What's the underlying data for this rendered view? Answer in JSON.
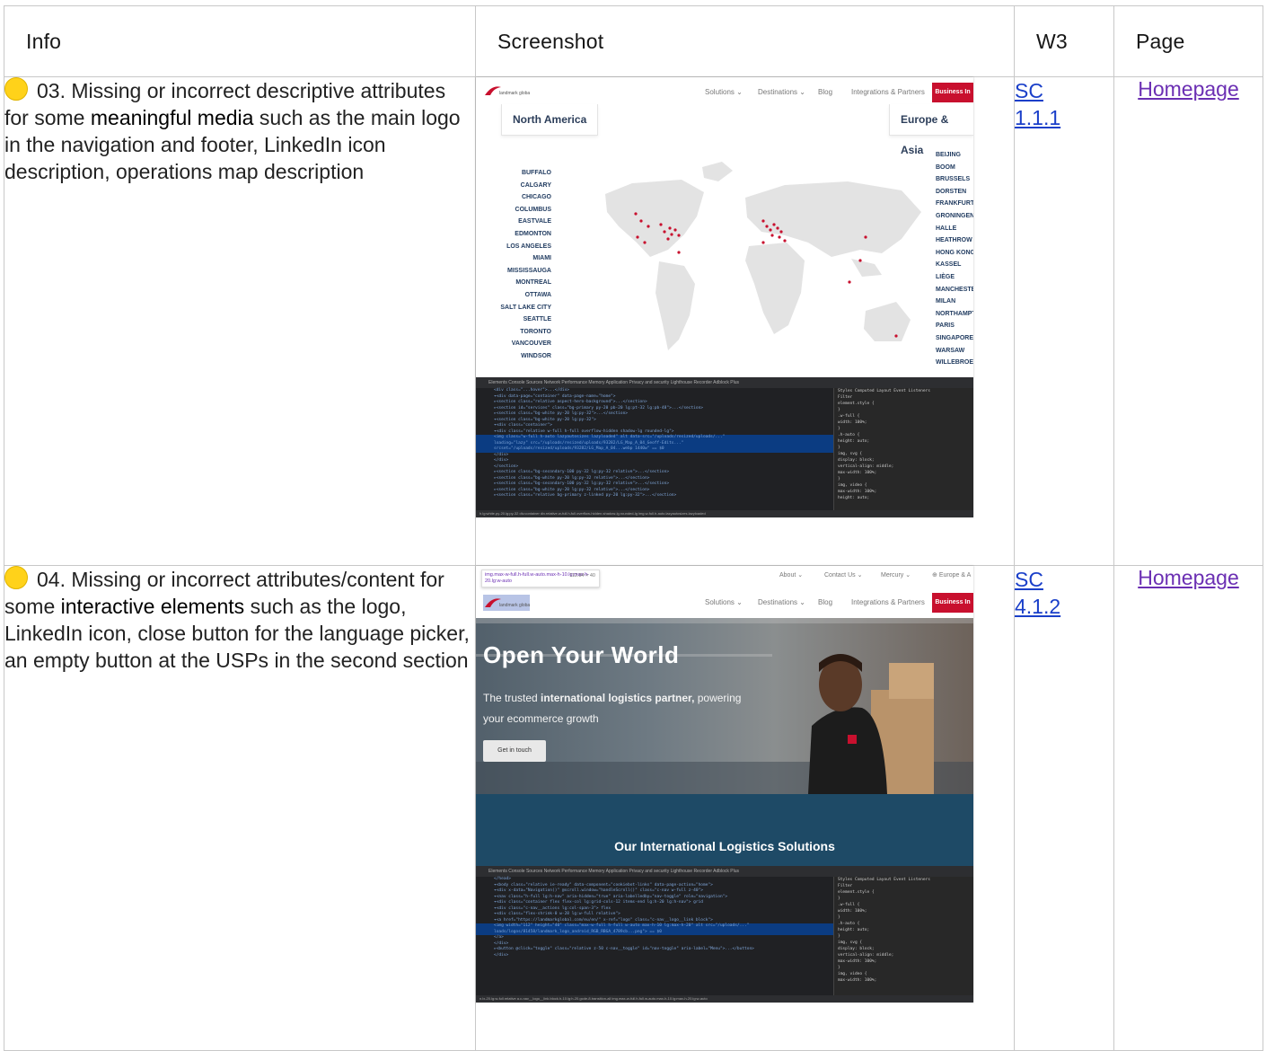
{
  "headers": {
    "info": "Info",
    "screenshot": "Screenshot",
    "w3": "W3",
    "page": "Page"
  },
  "rows": [
    {
      "status_color": "#ffd21a",
      "info_pre": "03. Missing or incorrect descriptive attributes for some ",
      "info_strong": "meaningful media",
      "info_post": " such as the main logo in the navigation and footer, LinkedIn icon description, operations map description",
      "w3_line1": "SC",
      "w3_line2": "1.1.1",
      "page_link": "Homepage",
      "screenshot": {
        "nav_links": [
          "Solutions ⌄",
          "Destinations ⌄",
          "Blog",
          "Integrations & Partners"
        ],
        "business_button": "Business In",
        "region_left": "North America",
        "region_right": "Europe & Asia",
        "cities_left": [
          "BUFFALO",
          "CALGARY",
          "CHICAGO",
          "COLUMBUS",
          "EASTVALE",
          "EDMONTON",
          "LOS ANGELES",
          "MIAMI",
          "MISSISSAUGA",
          "MONTREAL",
          "OTTAWA",
          "SALT LAKE CITY",
          "SEATTLE",
          "TORONTO",
          "VANCOUVER",
          "WINDSOR"
        ],
        "cities_right": [
          "BEIJING",
          "BOOM",
          "BRUSSELS",
          "DORSTEN",
          "FRANKFURT",
          "GRONINGEN",
          "HALLE",
          "HEATHROW",
          "HONG KONG",
          "KASSEL",
          "LIÈGE",
          "MANCHESTER",
          "MILAN",
          "NORTHAMPTON",
          "PARIS",
          "SINGAPORE",
          "WARSAW",
          "WILLEBROEK"
        ],
        "devtools_tabs": "Elements   Console   Sources   Network   Performance   Memory   Application   Privacy and security   Lighthouse   Recorder   Adblock Plus",
        "devtools_styles": [
          "Styles   Computed   Layout   Event Listeners",
          "Filter",
          "element.style {",
          "}",
          ".w-full {",
          "  width: 100%;",
          "}",
          ".h-auto {",
          "  height: auto;",
          "}",
          "img, svg {",
          "  display: block;",
          "  vertical-align: middle;",
          "  max-width: 100%;",
          "}",
          "img, video {",
          "  max-width: 100%;",
          "  height: auto;"
        ],
        "devtools_footer": "h.lg:white.py-20.lg:py-32   div.container   div.relative.w-full.h-full.overflow-hidden.shadow-lg.rounded-lg   img.w-full.h-auto.lazyautosizes.lazyloaded"
      }
    },
    {
      "status_color": "#ffd21a",
      "info_pre": "04. Missing or incorrect attributes/content for some ",
      "info_strong": "interactive elements",
      "info_post": " such as the logo, LinkedIn icon, close button for the language picker, an empty button at the USPs in the second section",
      "w3_line1": "SC",
      "w3_line2": "4.1.2",
      "page_link": "Homepage",
      "screenshot": {
        "tooltip_selector": "img.max-w-full.h-full.w-auto.max-h-10.lg:max-h-20.lg:w-auto",
        "tooltip_size": "112.84 × 40",
        "top_links": [
          "About ⌄",
          "Contact Us ⌄",
          "Mercury ⌄",
          "Europe & A"
        ],
        "nav_links": [
          "Solutions ⌄",
          "Destinations ⌄",
          "Blog",
          "Integrations & Partners"
        ],
        "business_button": "Business In",
        "hero_title": "Open Your World",
        "hero_sub_pre": "The trusted ",
        "hero_sub_strong": "international logistics partner,",
        "hero_sub_post": " powering your ecommerce growth",
        "cta": "Get in touch",
        "band_title": "Our International Logistics Solutions",
        "devtools_tabs": "Elements   Console   Sources   Network   Performance   Memory   Application   Privacy and security   Lighthouse   Recorder   Adblock Plus",
        "devtools_footer": "n.lx-20.lg:w-full.relative   a.c-nav__logo__link.block.h-10.lg:h-20.gcde-8.transition-all   img.max-w-full.h-full.w-auto.max-h-10.lg:max-h-20.lg:w-auto"
      }
    }
  ]
}
